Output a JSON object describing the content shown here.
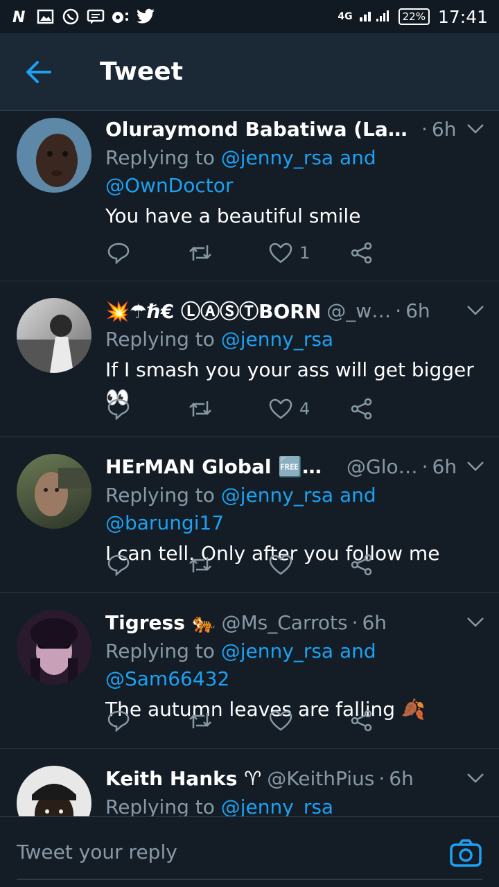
{
  "status_bar": {
    "network": "4G",
    "battery": "22%",
    "time": "17:41"
  },
  "header": {
    "title": "Tweet"
  },
  "tweets": [
    {
      "name": "Oluraymond Babatiwa (Lampar…",
      "handle": "",
      "age": "6h",
      "reply_prefix": "Replying to",
      "mentions": "@jenny_rsa and @OwnDoctor",
      "text": "You have a beautiful smile",
      "likes": "1",
      "avatar_color": "#5e88a7"
    },
    {
      "name": "💥☂ℏ€ ⓁⒶⓈⓉBORN",
      "handle": "@_w…",
      "age": "6h",
      "reply_prefix": "Replying to",
      "mentions": "@jenny_rsa",
      "text": "If I smash you your ass will get bigger 👀",
      "likes": "4",
      "avatar_color": "#9a9a9a"
    },
    {
      "name": "HErMAN Global 🆓🇮🇳🇳🇬",
      "handle": "@Glo…",
      "age": "6h",
      "reply_prefix": "Replying to",
      "mentions": "@jenny_rsa and @barungi17",
      "text": "I can tell. Only after you follow me",
      "likes": "",
      "avatar_color": "#4f5b44"
    },
    {
      "name": "Tigress 🐅",
      "handle": "@Ms_Carrots",
      "age": "6h",
      "reply_prefix": "Replying to",
      "mentions": "@jenny_rsa and @Sam66432",
      "text": "The autumn leaves are falling 🍂",
      "likes": "",
      "avatar_color": "#2a1a2e"
    },
    {
      "name": "Keith Hanks ♈",
      "handle": "@KeithPius",
      "age": "6h",
      "reply_prefix": "Replying to",
      "mentions": "@jenny_rsa",
      "text": "",
      "likes": "",
      "avatar_color": "#b8b8b8"
    }
  ],
  "composer": {
    "placeholder": "Tweet your reply"
  },
  "colors": {
    "accent": "#1da1f2",
    "muted": "#8899a6",
    "background": "#141d26"
  },
  "icons": [
    "arrow-left-icon",
    "chevron-down-icon",
    "reply-icon",
    "retweet-icon",
    "heart-icon",
    "share-icon",
    "camera-icon"
  ]
}
